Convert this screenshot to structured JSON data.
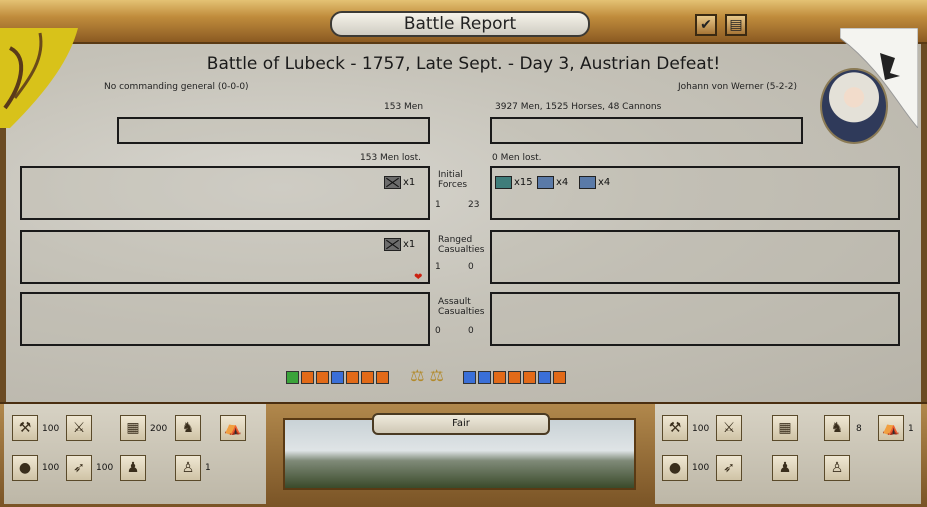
{
  "header": {
    "title": "Battle Report"
  },
  "battle": {
    "title": "Battle of Lubeck - 1757, Late Sept. - Day 3, Austrian Defeat!",
    "left_general": "No commanding general (0-0-0)",
    "right_general": "Johann von Werner (5-2-2)",
    "left_strength": "153 Men",
    "right_strength": "3927 Men, 1525 Horses, 48 Cannons",
    "left_lost": "153 Men lost.",
    "right_lost": "0 Men lost."
  },
  "rows": {
    "initial": {
      "label1": "Initial",
      "label2": "Forces",
      "left": "1",
      "right": "23"
    },
    "ranged": {
      "label1": "Ranged",
      "label2": "Casualties",
      "left": "1",
      "right": "0"
    },
    "assault": {
      "label1": "Assault",
      "label2": "Casualties",
      "left": "0",
      "right": "0"
    }
  },
  "units": {
    "initial_left": [
      {
        "icon": "grey-unit-icon",
        "count": "x1"
      }
    ],
    "initial_right": [
      {
        "icon": "teal-cavalry-icon",
        "count": "x15"
      },
      {
        "icon": "blue-artillery-icon",
        "count": "x4"
      },
      {
        "icon": "blue-infantry-icon",
        "count": "x4"
      }
    ],
    "ranged_left": [
      {
        "icon": "grey-unit-icon",
        "count": "x1"
      }
    ]
  },
  "weather": {
    "label": "Fair"
  },
  "bottom_left": {
    "values": [
      "100",
      "100",
      "200",
      "100",
      "1"
    ]
  },
  "bottom_right": {
    "values": [
      "100",
      "8",
      "1",
      "100"
    ]
  },
  "colors": {
    "frame": "#8b5a22",
    "parchment": "#c5c2b8",
    "austrian": "#e26a18",
    "prussian": "#3a6fd8"
  }
}
